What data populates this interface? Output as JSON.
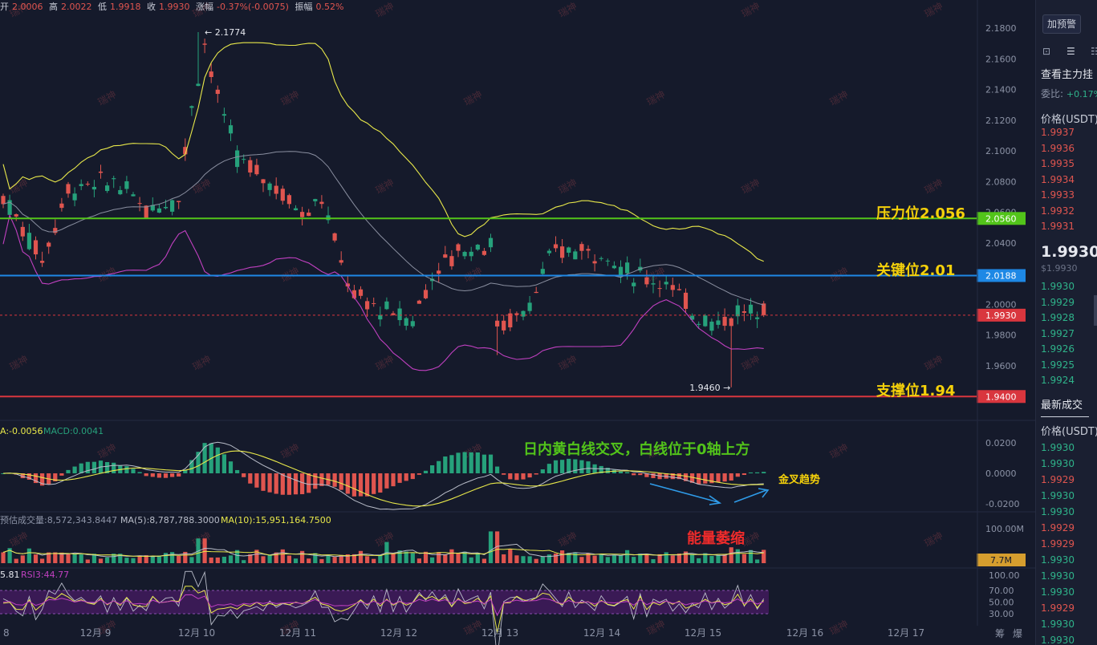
{
  "header": {
    "open_label": "开",
    "open_value": "2.0006",
    "high_label": "高",
    "high_value": "2.0022",
    "low_label": "低",
    "low_value": "1.9918",
    "close_label": "收",
    "close_value": "1.9930",
    "change_label": "涨幅",
    "change_value": "-0.37%(-0.0075)",
    "amp_label": "振幅",
    "amp_value": "0.52%"
  },
  "watermark_text": "瑞神",
  "price_axis": {
    "ticks": [
      "2.1800",
      "2.1600",
      "2.1400",
      "2.1200",
      "2.1000",
      "2.0800",
      "2.0600",
      "2.0400",
      "2.0200",
      "2.0000",
      "1.9800",
      "1.9600"
    ],
    "tag_resistance": "2.0560",
    "tag_key": "2.0188",
    "tag_current": "1.9930",
    "tag_support": "1.9400",
    "colors": {
      "resistance": "#52c41a",
      "key": "#1e88e5",
      "current": "#d9363e",
      "support": "#d9363e"
    }
  },
  "annotations": {
    "high_marker": "← 2.1774",
    "low_marker": "1.9460 →",
    "resistance": "压力位2.056",
    "key": "关键位2.01",
    "support": "支撑位1.94",
    "macd_note": "日内黄白线交叉，白线位于0轴上方",
    "golden_cross": "金叉趋势",
    "volume_note": "能量萎缩"
  },
  "macd_panel": {
    "legend_dea": "A:-0.0056",
    "legend_macd": "MACD:0.0041",
    "ticks": [
      "0.0200",
      "0.0000",
      "-0.0200"
    ]
  },
  "volume_panel": {
    "legend_est": "预估成交量:8,572,343.8447",
    "legend_ma5": "MA(5):8,787,788.3000",
    "legend_ma10": "MA(10):15,951,164.7500",
    "ticks": [
      "100.00M"
    ],
    "tag_current": "7.7M"
  },
  "rsi_panel": {
    "legend_rsi1": "5.81",
    "legend_rsi3": "RSI3:44.77",
    "ticks": [
      "100.00",
      "70.00",
      "50.00",
      "30.00"
    ]
  },
  "time_axis": {
    "labels": [
      "8",
      "12月 9",
      "12月 10",
      "12月 11",
      "12月 12",
      "12月 13",
      "12月 14",
      "12月 15",
      "12月 16",
      "12月 17"
    ],
    "corner_left": "筹",
    "corner_right": "爆"
  },
  "chart_data": {
    "type": "candlestick",
    "title": "",
    "price_range": [
      1.93,
      2.19
    ],
    "levels": {
      "resistance": 2.056,
      "key": 2.0188,
      "current": 1.993,
      "support": 1.94
    },
    "extremes": {
      "high": 2.1774,
      "low": 1.946
    },
    "days": [
      "12月 9",
      "12月 10",
      "12月 11",
      "12月 12",
      "12月 13",
      "12月 14",
      "12月 15",
      "12月 16",
      "12月 17"
    ],
    "indicators": [
      "Bollinger Bands",
      "MACD",
      "Volume",
      "RSI"
    ]
  },
  "side": {
    "alert_button": "加预警",
    "book_title": "查看主力挂",
    "ratio_label": "委比:",
    "ratio_value": "+0.17%",
    "price_header": "价格(USDT)",
    "asks": [
      "1.9937",
      "1.9936",
      "1.9935",
      "1.9934",
      "1.9933",
      "1.9932",
      "1.9931"
    ],
    "last_price": "1.9930",
    "last_price_usd": "$1.9930",
    "bids": [
      "1.9930",
      "1.9929",
      "1.9928",
      "1.9927",
      "1.9926",
      "1.9925",
      "1.9924"
    ],
    "trades_title": "最新成交",
    "trades_header": "价格(USDT)",
    "trades": [
      {
        "p": "1.9930",
        "c": "green"
      },
      {
        "p": "1.9930",
        "c": "green"
      },
      {
        "p": "1.9929",
        "c": "red"
      },
      {
        "p": "1.9930",
        "c": "green"
      },
      {
        "p": "1.9930",
        "c": "green"
      },
      {
        "p": "1.9929",
        "c": "red"
      },
      {
        "p": "1.9929",
        "c": "red"
      },
      {
        "p": "1.9930",
        "c": "green"
      },
      {
        "p": "1.9930",
        "c": "green"
      },
      {
        "p": "1.9930",
        "c": "green"
      },
      {
        "p": "1.9929",
        "c": "red"
      },
      {
        "p": "1.9930",
        "c": "green"
      },
      {
        "p": "1.9930",
        "c": "green"
      }
    ]
  }
}
